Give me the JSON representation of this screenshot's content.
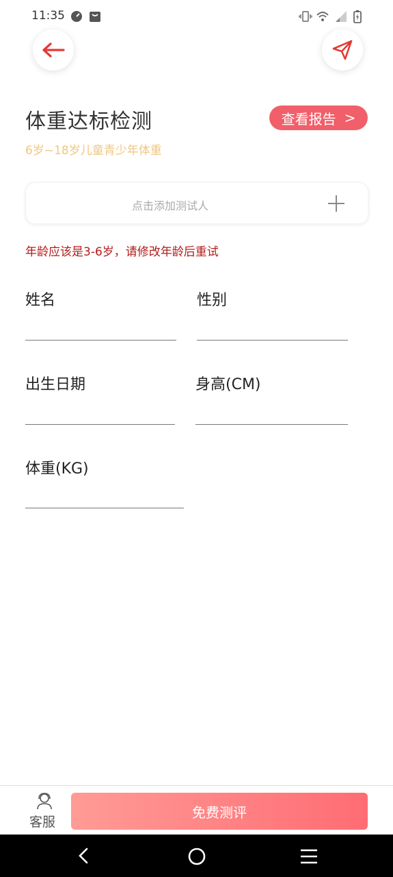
{
  "status_bar": {
    "time": "11:35",
    "icons": [
      "speedometer-icon",
      "bag-icon",
      "vibrate-icon",
      "wifi-icon",
      "signal-icon",
      "battery-charging-icon"
    ]
  },
  "header": {
    "back_icon": "arrow-left-icon",
    "share_icon": "paper-plane-icon",
    "accent_color": "#e53935"
  },
  "title": {
    "main": "体重达标检测",
    "subtitle": "6岁~18岁儿童青少年体重",
    "report_button": "查看报告",
    "report_arrow": ">"
  },
  "add_tester": {
    "label": "点击添加测试人",
    "icon": "plus-icon"
  },
  "warning": "年龄应该是3-6岁，请修改年龄后重试",
  "form": {
    "name_label": "姓名",
    "gender_label": "性别",
    "birth_label": "出生日期",
    "height_label": "身高(CM)",
    "weight_label": "体重(KG)"
  },
  "bottom": {
    "service_label": "客服",
    "service_icon": "headset-person-icon",
    "evaluate_button": "免费测评"
  },
  "nav": {
    "icons": [
      "nav-back-icon",
      "nav-home-icon",
      "nav-menu-icon"
    ]
  }
}
